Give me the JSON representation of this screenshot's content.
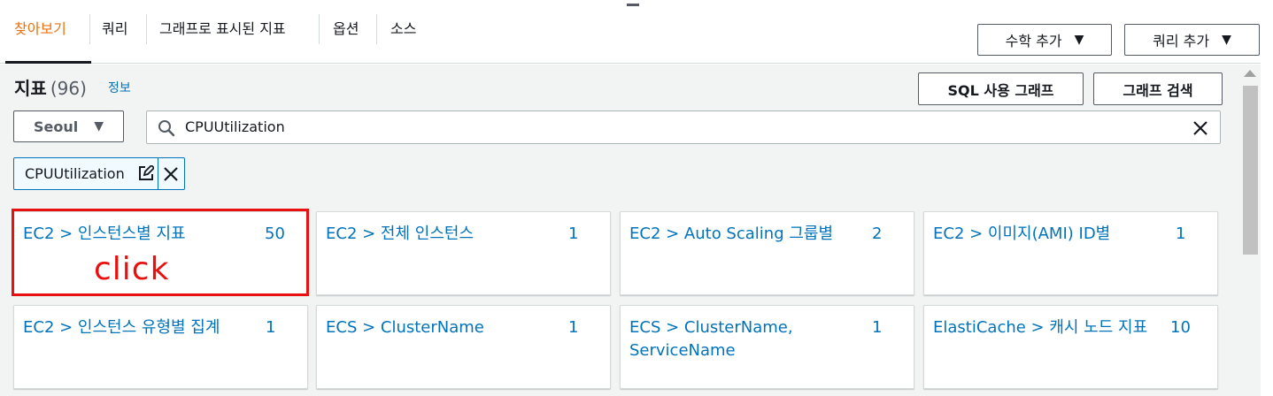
{
  "tabs": [
    {
      "label": "찾아보기",
      "active": true
    },
    {
      "label": "쿼리",
      "active": false
    },
    {
      "label": "그래프로 표시된 지표",
      "active": false
    },
    {
      "label": "옵션",
      "active": false
    },
    {
      "label": "소스",
      "active": false
    }
  ],
  "header_buttons": {
    "add_math": "수학 추가",
    "add_query": "쿼리 추가"
  },
  "metrics": {
    "title": "지표",
    "count": "(96)",
    "info": "정보",
    "graph_with_sql": "SQL 사용 그래프",
    "graph_search": "그래프 검색"
  },
  "region": "Seoul",
  "search": {
    "value": "CPUUtilization"
  },
  "filter_token": "CPUUtilization",
  "cards": [
    {
      "name": "EC2 > 인스턴스별 지표",
      "count": "50"
    },
    {
      "name": "EC2 > 전체 인스턴스",
      "count": "1"
    },
    {
      "name": "EC2 > Auto Scaling 그룹별",
      "count": "2"
    },
    {
      "name": "EC2 > 이미지(AMI) ID별",
      "count": "1"
    },
    {
      "name": "EC2 > 인스턴스 유형별 집계",
      "count": "1"
    },
    {
      "name": "ECS > ClusterName",
      "count": "1"
    },
    {
      "name": "ECS > ClusterName, ServiceName",
      "count": "1"
    },
    {
      "name": "ElastiCache > 캐시 노드 지표",
      "count": "10"
    }
  ],
  "annotation": "click",
  "colors": {
    "accent": "#ec7211",
    "link": "#0073bb",
    "annotation": "#e8110f"
  }
}
